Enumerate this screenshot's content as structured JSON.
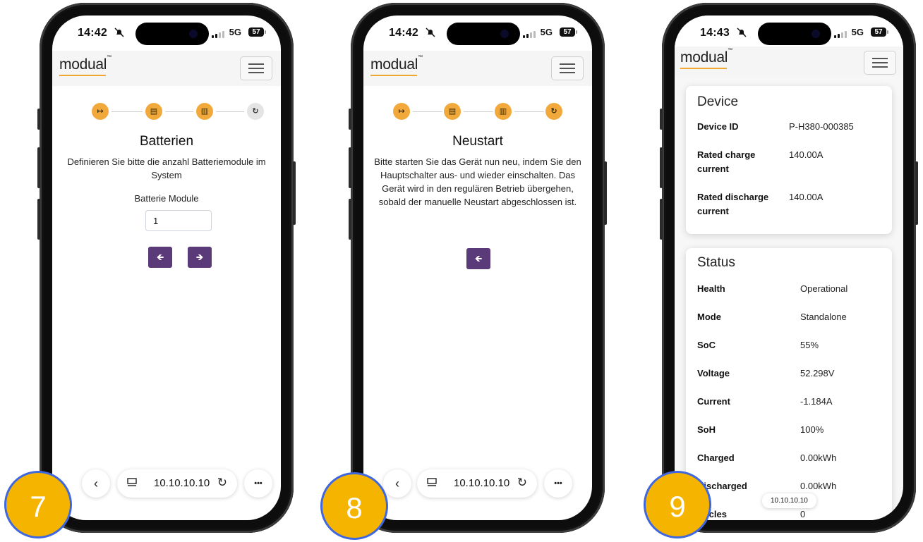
{
  "colors": {
    "accent_orange": "#f2a93b",
    "button_purple": "#5a3a78",
    "badge_yellow": "#f5b400",
    "badge_border": "#3f67e0"
  },
  "phone7": {
    "status": {
      "time": "14:42",
      "network": "5G",
      "battery": "57"
    },
    "logo": "modual",
    "steps": [
      {
        "icon": "arrow-right-to-bar-icon",
        "glyph": "↦",
        "active": true
      },
      {
        "icon": "document-icon",
        "glyph": "▤",
        "active": true
      },
      {
        "icon": "battery-icon",
        "glyph": "▥",
        "active": true
      },
      {
        "icon": "restart-icon",
        "glyph": "↻",
        "active": false
      }
    ],
    "title": "Batterien",
    "description": "Definieren Sie bitte die anzahl Batteriemodule im System",
    "field_label": "Batterie Module",
    "field_value": "1",
    "back_glyph": "🡸",
    "next_glyph": "🡺",
    "url": "10.10.10.10",
    "badge": "7"
  },
  "phone8": {
    "status": {
      "time": "14:42",
      "network": "5G",
      "battery": "57"
    },
    "logo": "modual",
    "steps": [
      {
        "icon": "arrow-right-to-bar-icon",
        "glyph": "↦",
        "active": true
      },
      {
        "icon": "document-icon",
        "glyph": "▤",
        "active": true
      },
      {
        "icon": "battery-icon",
        "glyph": "▥",
        "active": true
      },
      {
        "icon": "restart-icon",
        "glyph": "↻",
        "active": true
      }
    ],
    "title": "Neustart",
    "description": "Bitte starten Sie das Gerät nun neu, indem Sie den Hauptschalter aus- und wieder einschalten. Das Gerät wird in den regulären Betrieb übergehen, sobald der manuelle Neustart abgeschlossen ist.",
    "back_glyph": "🡸",
    "url": "10.10.10.10",
    "badge": "8"
  },
  "phone9": {
    "status": {
      "time": "14:43",
      "network": "5G",
      "battery": "57"
    },
    "logo": "modual",
    "device_card": {
      "title": "Device",
      "rows": [
        {
          "key": "Device ID",
          "value": "P-H380-000385"
        },
        {
          "key": "Rated charge current",
          "value": "140.00A"
        },
        {
          "key": "Rated discharge current",
          "value": "140.00A"
        }
      ]
    },
    "status_card": {
      "title": "Status",
      "rows": [
        {
          "key": "Health",
          "value": "Operational"
        },
        {
          "key": "Mode",
          "value": "Standalone"
        },
        {
          "key": "SoC",
          "value": "55%"
        },
        {
          "key": "Voltage",
          "value": "52.298V"
        },
        {
          "key": "Current",
          "value": "-1.184A"
        },
        {
          "key": "SoH",
          "value": "100%"
        },
        {
          "key": "Charged",
          "value": "0.00kWh"
        },
        {
          "key": "Discharged",
          "value": "0.00kWh"
        },
        {
          "key": "Cycles",
          "value": "0"
        }
      ]
    },
    "url_tooltip": "10.10.10.10",
    "badge": "9"
  },
  "browser": {
    "back_glyph": "‹",
    "more_glyph": "•••",
    "reload_glyph": "↻"
  }
}
